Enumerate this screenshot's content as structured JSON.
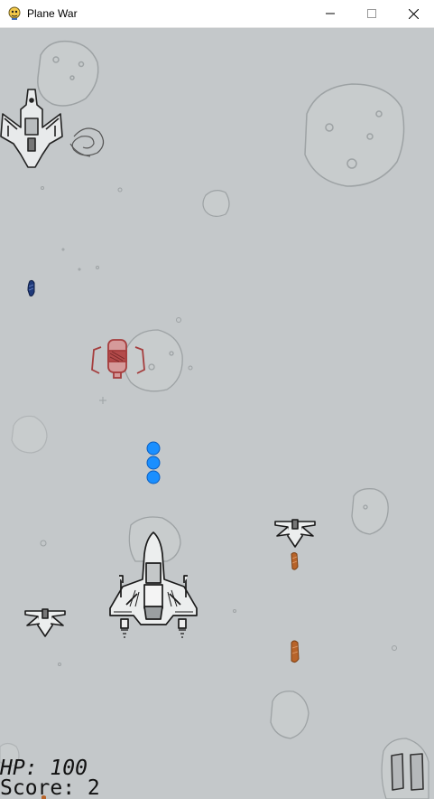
{
  "window": {
    "title": "Plane War",
    "controls": {
      "minimize_icon": "minimize-icon",
      "maximize_icon": "maximize-icon",
      "close_icon": "close-icon"
    }
  },
  "hud": {
    "hp_text": "HP: 100",
    "score_text": "Score: 2"
  },
  "colors": {
    "background": "#c4c8ca",
    "player_bullet": "#1a8fff",
    "enemy_bullet_orange": "#b8642a",
    "enemy_bullet_blue": "#1f3a7a",
    "powerup_red": "#b34a4a"
  }
}
